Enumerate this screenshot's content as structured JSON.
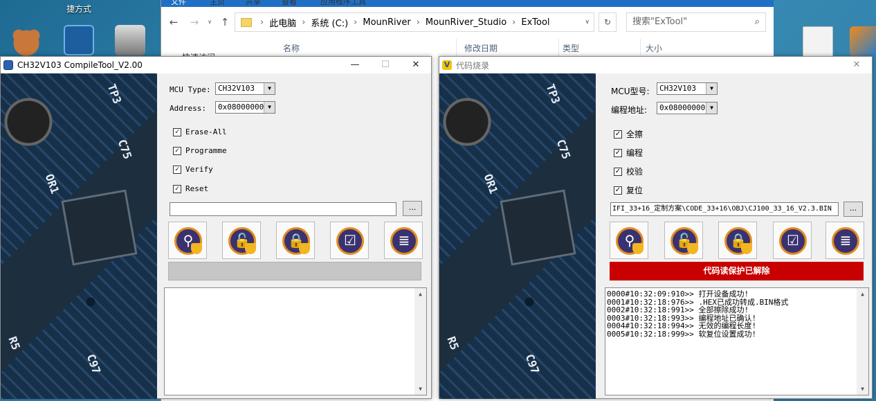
{
  "desktop": {
    "shortcut_label": "捷方式",
    "icons": [
      "bear-app-icon",
      "app-icon",
      "camera-icon",
      "file-settings-icon",
      "app-shortcut-icon"
    ]
  },
  "explorer": {
    "ribbon": [
      "文件",
      "主页",
      "共享",
      "查看",
      "应用程序工具"
    ],
    "breadcrumb": [
      "此电脑",
      "系统 (C:)",
      "MounRiver",
      "MounRiver_Studio",
      "ExTool"
    ],
    "search_placeholder": "搜索\"ExTool\"",
    "columns": [
      "名称",
      "修改日期",
      "类型",
      "大小"
    ],
    "sidebar_first": "快速访问"
  },
  "compile_tool": {
    "title": "CH32V103 CompileTool_V2.00",
    "mcu_label": "MCU Type:",
    "mcu_value": "CH32V103",
    "addr_label": "Address:",
    "addr_value": "0x08000000",
    "checkboxes": [
      "Erase-All",
      "Programme",
      "Verify",
      "Reset"
    ],
    "file_path": "",
    "browse_label": "...",
    "log_lines": []
  },
  "burn_tool": {
    "title": "代码烧录",
    "mcu_label": "MCU型号:",
    "mcu_value": "CH32V103",
    "addr_label": "编程地址:",
    "addr_value": "0x08000000",
    "checkboxes": [
      "全擦",
      "编程",
      "校验",
      "复位"
    ],
    "file_path": "IFI_33+16_定制方案\\CODE_33+16\\OBJ\\CJ100_33_16_V2.3.BIN",
    "browse_label": "...",
    "status_banner": "代码读保护已解除",
    "log_lines": [
      "0000#10:32:09:910>> 打开设备成功!",
      "0001#10:32:18:976>> .HEX已成功转成.BIN格式",
      "0002#10:32:18:991>> 全部擦除成功!",
      "0003#10:32:18:993>> 编程地址已确认!",
      "0004#10:32:18:994>> 无效的编程长度!",
      "0005#10:32:18:999>> 软复位设置成功!"
    ]
  },
  "action_buttons": [
    "query-button",
    "unprotect-button",
    "protect-button",
    "verify-button",
    "download-button"
  ],
  "colors": {
    "banner": "#c80000",
    "button_disc": "#3a3270",
    "button_ring": "#e48c1e",
    "explorer_ribbon": "#1f6fc5"
  }
}
